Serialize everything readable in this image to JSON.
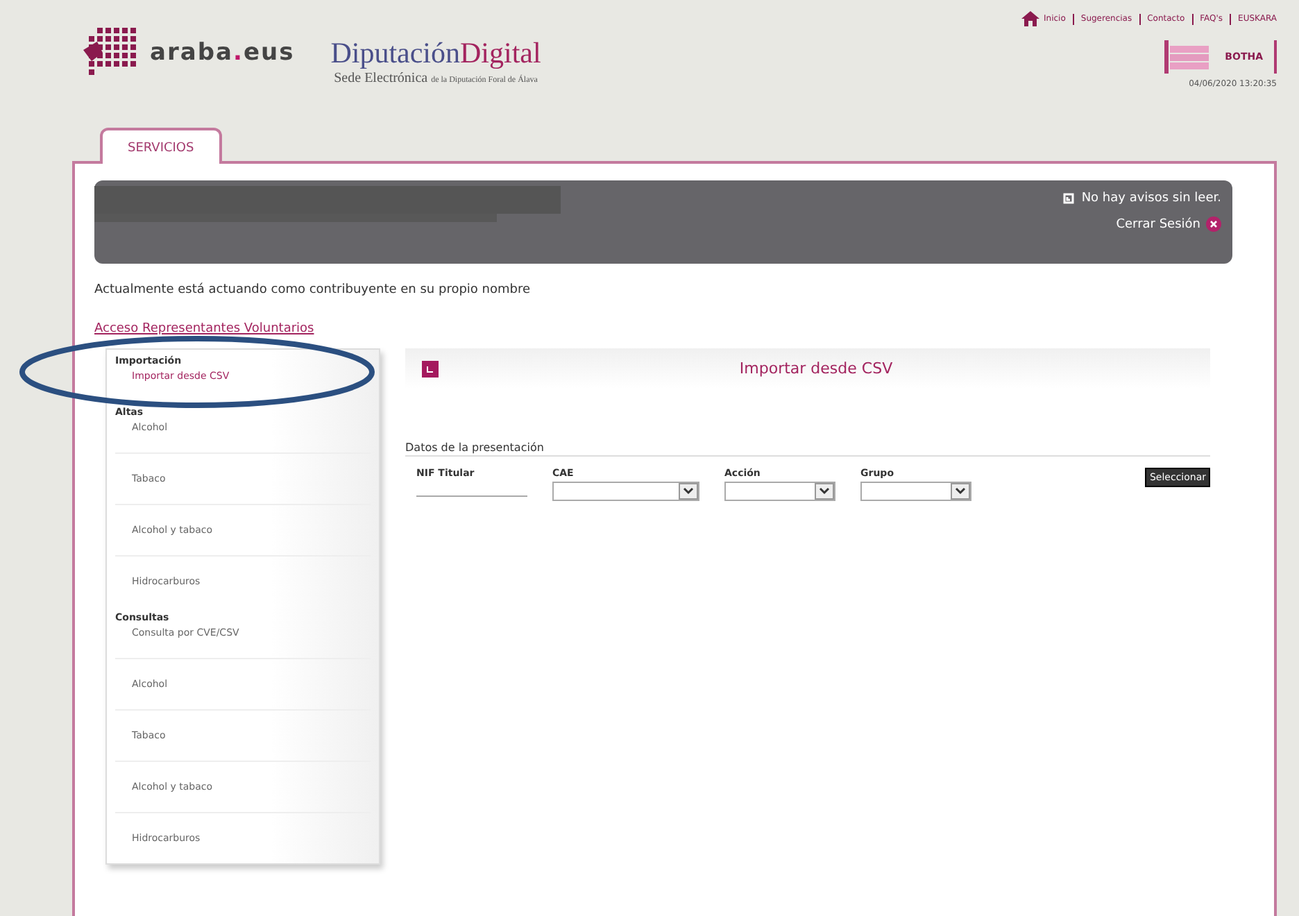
{
  "header": {
    "logo_text": "araba",
    "logo_dot": ".",
    "logo_suffix": "eus",
    "brand_main": "Diputación",
    "brand_accent": "Digital",
    "brand_sub": "Sede Electrónica",
    "brand_sub_small": "de la Diputación Foral de Álava",
    "top_links": [
      "Inicio",
      "Sugerencias",
      "Contacto",
      "FAQ's",
      "EUSKARA"
    ],
    "botha": "BOTHA",
    "datetime": "04/06/2020 13:20:35"
  },
  "tabs": [
    {
      "label": "SERVICIOS",
      "selected": true
    }
  ],
  "user_bar": {
    "notice": "No hay avisos sin leer.",
    "logout": "Cerrar Sesión"
  },
  "acting_as": "Actualmente está actuando como contribuyente en su propio nombre",
  "representatives_link": "Acceso Representantes Voluntarios",
  "sidebar": [
    {
      "heading": "Importación",
      "items": [
        {
          "label": "Importar desde CSV",
          "selected": true
        }
      ]
    },
    {
      "heading": "Altas",
      "items": [
        {
          "label": "Alcohol",
          "selected": false
        },
        {
          "label": "Tabaco",
          "selected": false
        },
        {
          "label": "Alcohol y tabaco",
          "selected": false
        },
        {
          "label": "Hidrocarburos",
          "selected": false
        }
      ]
    },
    {
      "heading": "Consultas",
      "items": [
        {
          "label": "Consulta por CVE/CSV",
          "selected": false
        },
        {
          "label": "Alcohol",
          "selected": false
        },
        {
          "label": "Tabaco",
          "selected": false
        },
        {
          "label": "Alcohol y tabaco",
          "selected": false
        },
        {
          "label": "Hidrocarburos",
          "selected": false
        }
      ]
    }
  ],
  "panel": {
    "title": "Importar desde CSV",
    "section": "Datos de la presentación",
    "fields": [
      {
        "label": "NIF Titular",
        "kind": "text"
      },
      {
        "label": "CAE",
        "kind": "select"
      },
      {
        "label": "Acción",
        "kind": "select"
      },
      {
        "label": "Grupo",
        "kind": "select"
      }
    ],
    "button": "Seleccionar"
  }
}
